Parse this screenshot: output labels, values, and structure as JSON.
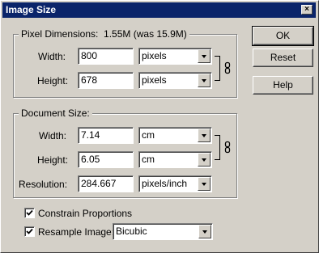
{
  "window": {
    "title": "Image Size",
    "close_glyph": "×"
  },
  "pixel_dimensions": {
    "legend": "Pixel Dimensions:",
    "size_info": "1.55M (was 15.9M)",
    "width_label": "Width:",
    "width_mnemonic": "W",
    "width_value": "800",
    "width_unit": "pixels",
    "height_label": "Height:",
    "height_mnemonic": "H",
    "height_value": "678",
    "height_unit": "pixels"
  },
  "document_size": {
    "legend": "Document Size:",
    "width_label": "Width:",
    "width_value": "7.14",
    "width_unit": "cm",
    "height_label": "Height:",
    "height_value": "6.05",
    "height_unit": "cm",
    "resolution_label": "Resolution:",
    "resolution_value": "284.667",
    "resolution_unit": "pixels/inch"
  },
  "options": {
    "constrain_label": "Constrain Proportions",
    "constrain_checked": true,
    "resample_label": "Resample Image:",
    "resample_checked": true,
    "resample_method": "Bicubic"
  },
  "buttons": {
    "ok": "OK",
    "reset": "Reset",
    "help": "Help"
  },
  "icons": {
    "close": "close-icon",
    "link": "chain-link-icon",
    "dropdown": "dropdown-arrow-icon",
    "check": "checkmark-icon"
  },
  "colors": {
    "titlebar": "#0a246a",
    "face": "#d4d0c8"
  }
}
